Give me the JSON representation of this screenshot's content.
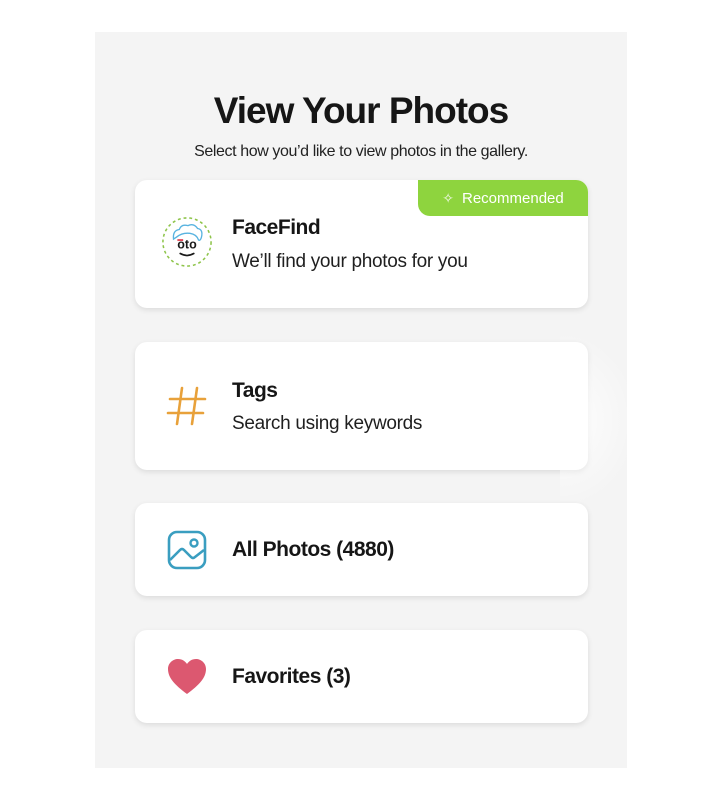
{
  "header": {
    "title": "View Your Photos",
    "subtitle": "Select how you’d like to view photos in the gallery."
  },
  "options": [
    {
      "name": "FaceFind",
      "description": "We’ll find your photos for you",
      "icon": "facefind-avatar-icon",
      "badge": "Recommended",
      "badge_icon": "sparkle-icon"
    },
    {
      "name": "Tags",
      "description": "Search using keywords",
      "icon": "hashtag-icon"
    },
    {
      "name": "All Photos (4880)",
      "icon": "image-icon"
    },
    {
      "name": "Favorites (3)",
      "icon": "heart-icon"
    }
  ],
  "colors": {
    "badge": "#8ed43e",
    "tags_icon": "#e8a13a",
    "image_icon": "#3a9ec0",
    "heart_icon": "#dc5870",
    "panel_bg": "#f4f4f4"
  }
}
